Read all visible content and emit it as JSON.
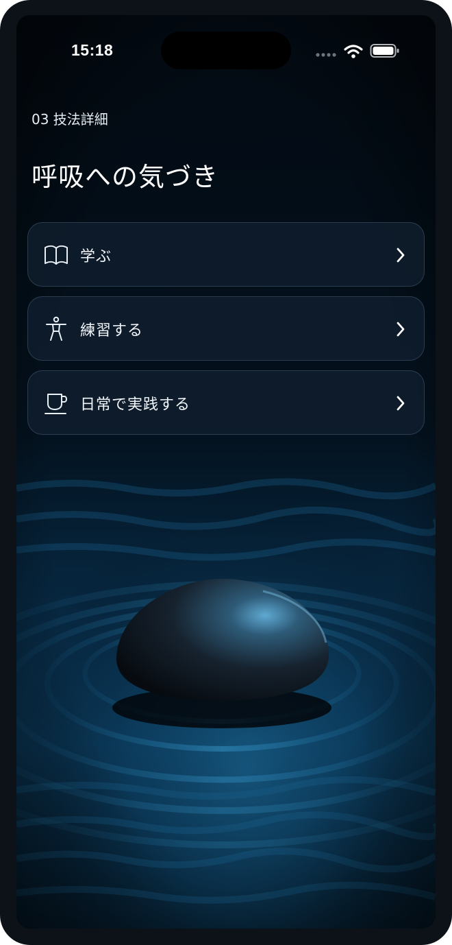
{
  "status_bar": {
    "time": "15:18",
    "icons": [
      "signal-dots-icon",
      "wifi-icon",
      "battery-icon"
    ]
  },
  "header": {
    "breadcrumb": "03 技法詳細",
    "title": "呼吸への気づき"
  },
  "menu": {
    "items": [
      {
        "label": "学ぶ",
        "icon": "open-book-icon"
      },
      {
        "label": "練習する",
        "icon": "person-icon"
      },
      {
        "label": "日常で実践する",
        "icon": "cup-icon"
      }
    ],
    "chevron_icon": "chevron-right-icon"
  },
  "background": {
    "description_icon": "stone-in-water-image",
    "colors": {
      "deep": "#030a12",
      "water": "#0b3a5a",
      "highlight": "#2a8fc4",
      "stone": "#1a2430"
    }
  }
}
